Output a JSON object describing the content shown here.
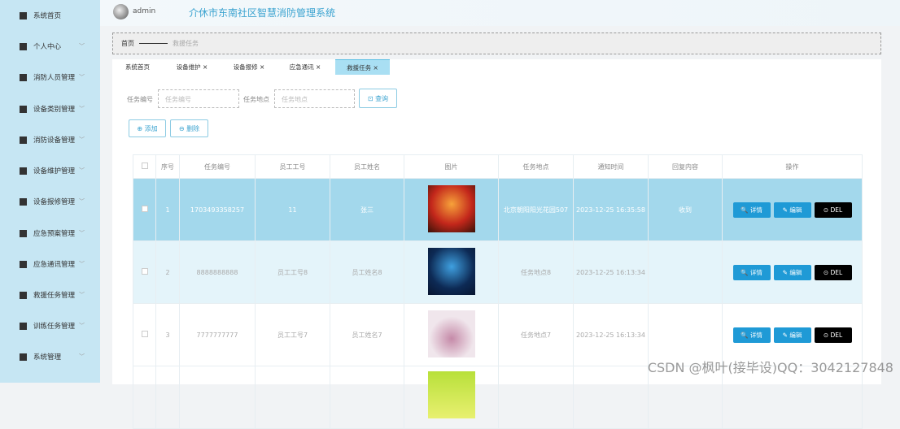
{
  "sidebar": {
    "items": [
      {
        "label": "系统首页"
      },
      {
        "label": "个人中心"
      },
      {
        "label": "消防人员管理"
      },
      {
        "label": "设备类别管理"
      },
      {
        "label": "消防设备管理"
      },
      {
        "label": "设备维护管理"
      },
      {
        "label": "设备报修管理"
      },
      {
        "label": "应急预案管理"
      },
      {
        "label": "应急通讯管理"
      },
      {
        "label": "救援任务管理"
      },
      {
        "label": "训练任务管理"
      },
      {
        "label": "系统管理"
      }
    ]
  },
  "header": {
    "user": "admin",
    "title": "介休市东南社区智慧消防管理系统"
  },
  "breadcrumb": {
    "home": "首页",
    "current": "救援任务"
  },
  "tabs": [
    {
      "label": "系统首页"
    },
    {
      "label": "设备维护 ×"
    },
    {
      "label": "设备报修 ×"
    },
    {
      "label": "应急通讯 ×"
    },
    {
      "label": "救援任务 ×"
    }
  ],
  "search": {
    "label1": "任务编号",
    "placeholder1": "任务编号",
    "label2": "任务地点",
    "placeholder2": "任务地点",
    "query": "查询"
  },
  "actions": {
    "add": "添加",
    "delete": "删除"
  },
  "table": {
    "headers": [
      "序号",
      "任务编号",
      "员工工号",
      "员工姓名",
      "图片",
      "任务地点",
      "通知时间",
      "回复内容",
      "操作"
    ],
    "rows": [
      {
        "no": "1",
        "code": "1703493358257",
        "emp_id": "11",
        "emp_name": "张三",
        "place": "北京朝阳阳光花园507",
        "time": "2023-12-25 16:35:58",
        "reply": "收到"
      },
      {
        "no": "2",
        "code": "8888888888",
        "emp_id": "员工工号8",
        "emp_name": "员工姓名8",
        "place": "任务地点8",
        "time": "2023-12-25 16:13:34",
        "reply": ""
      },
      {
        "no": "3",
        "code": "7777777777",
        "emp_id": "员工工号7",
        "emp_name": "员工姓名7",
        "place": "任务地点7",
        "time": "2023-12-25 16:13:34",
        "reply": ""
      }
    ],
    "detail": "详情",
    "edit": "编辑",
    "del": "DEL"
  },
  "watermark": "CSDN @枫叶(接毕设)QQ：3042127848"
}
